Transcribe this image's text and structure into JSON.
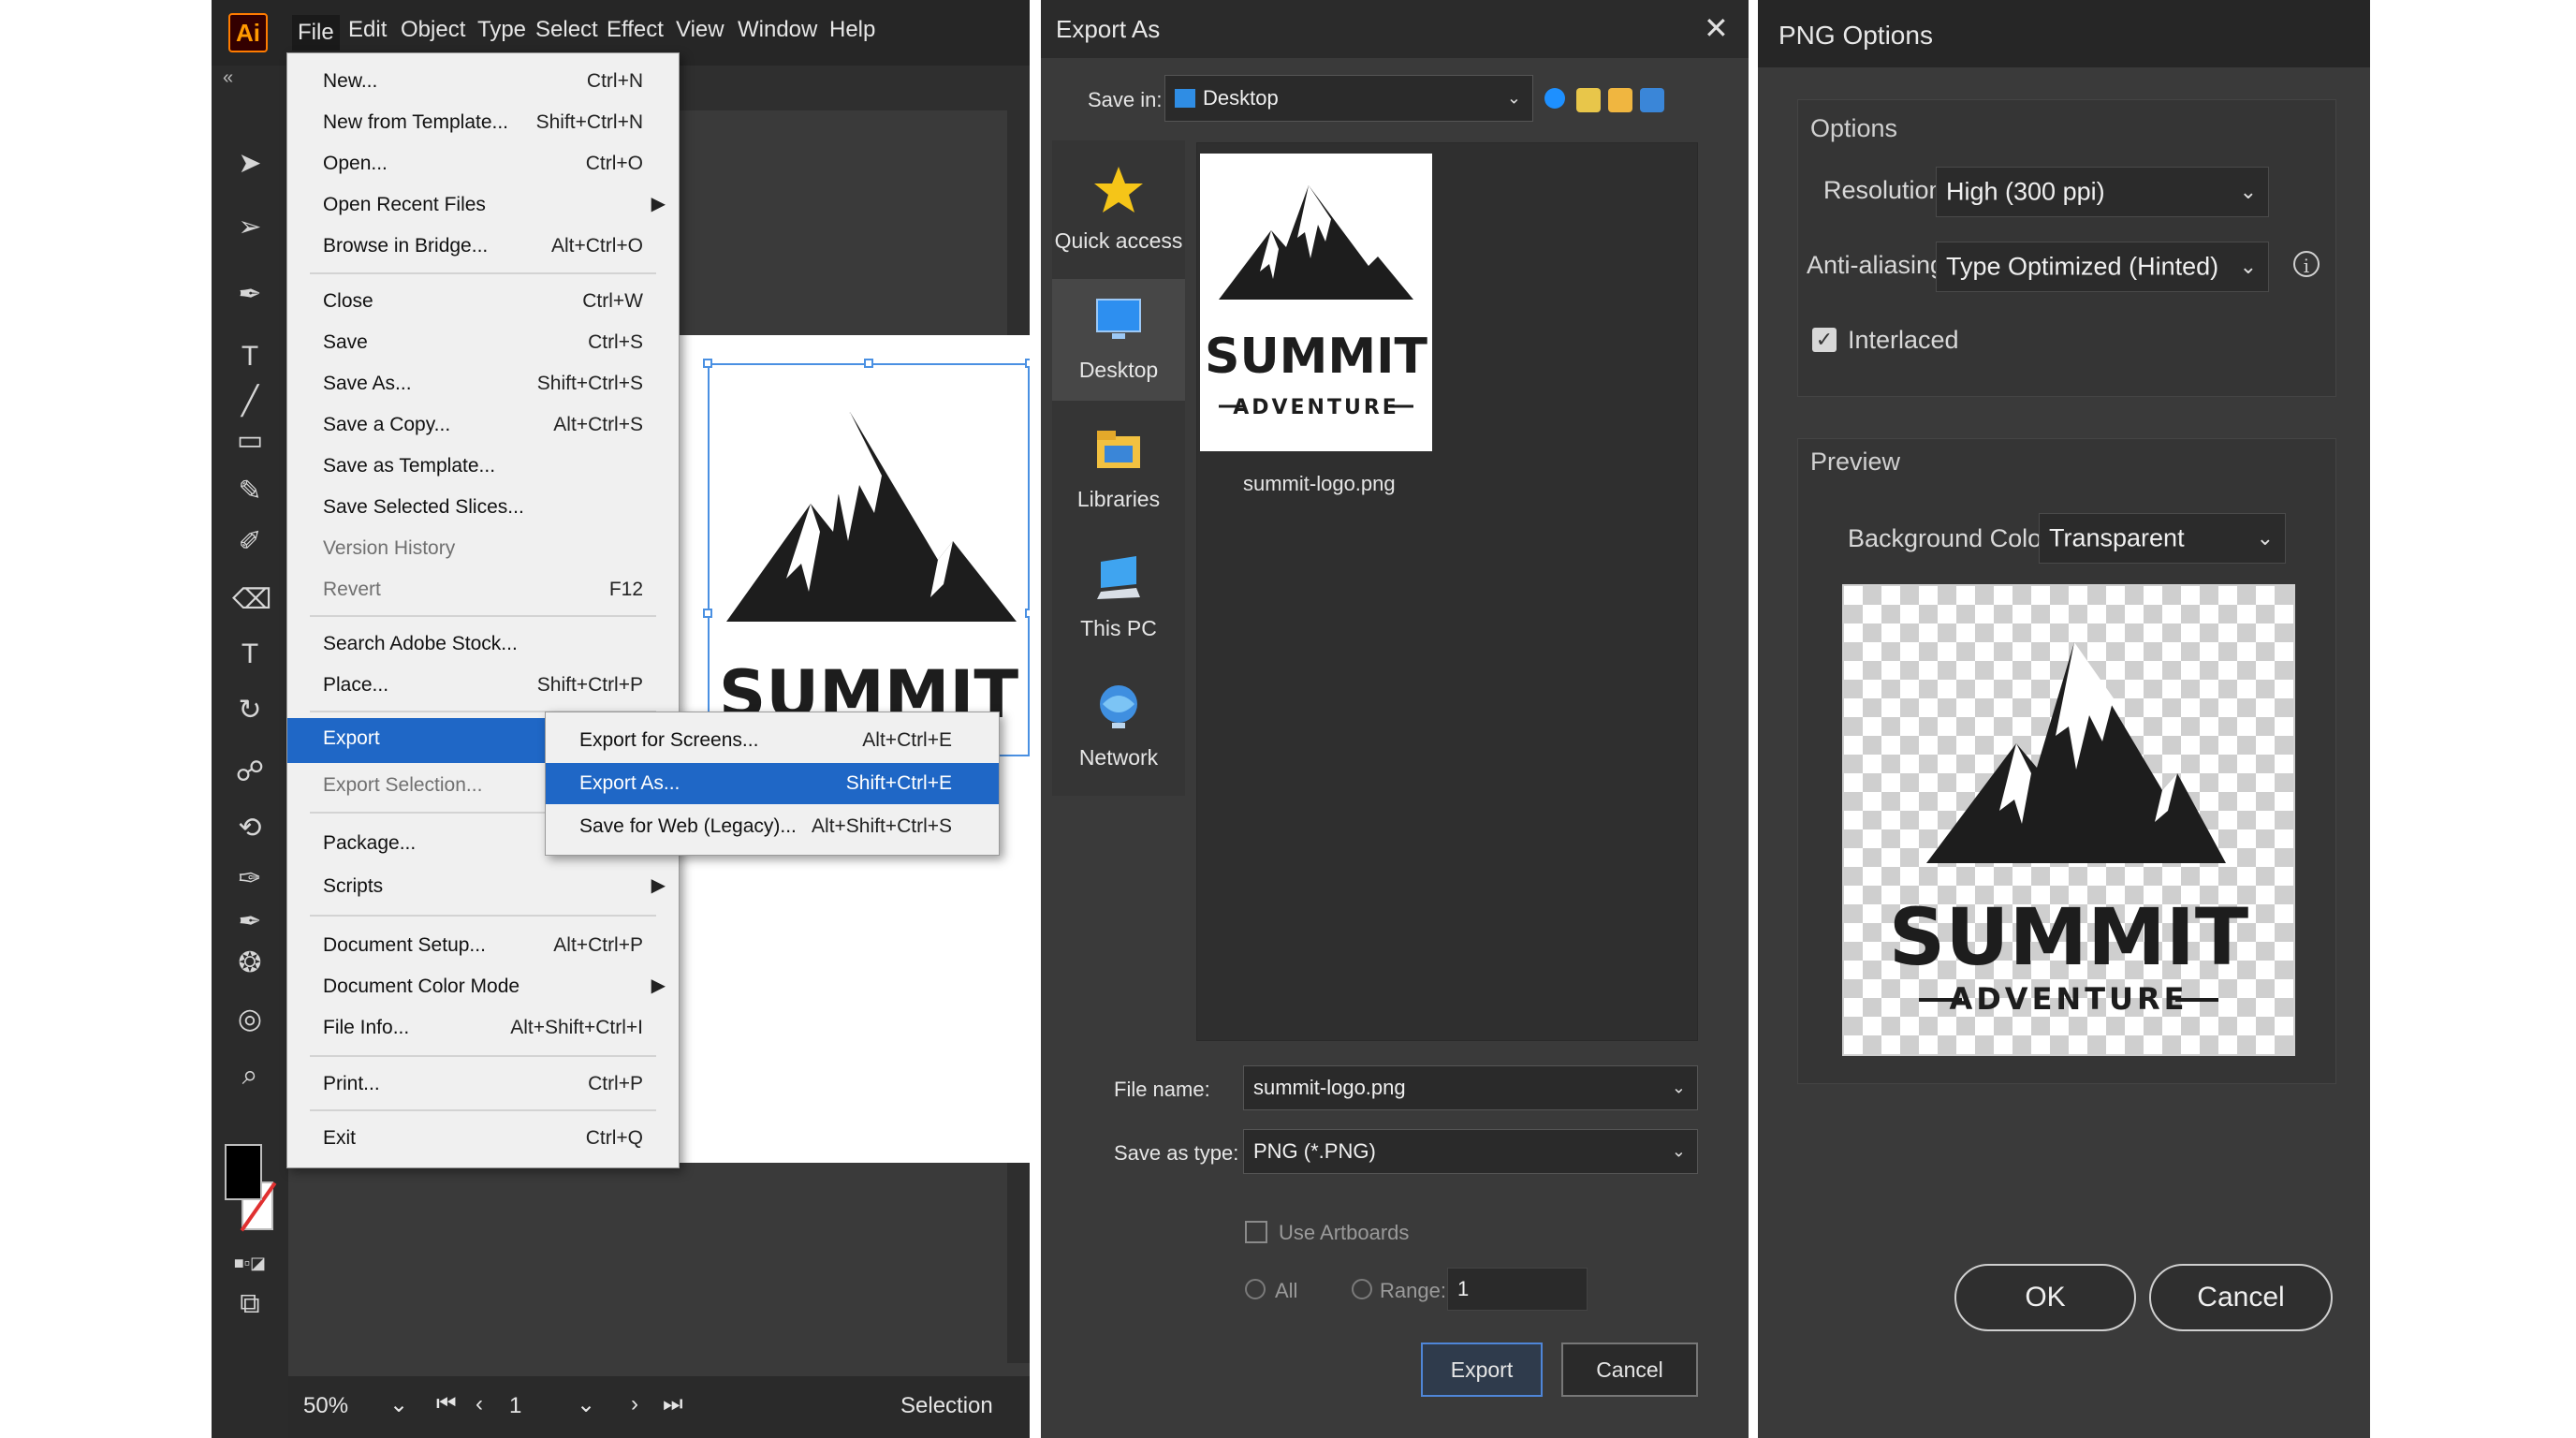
{
  "illustrator": {
    "app_logo": "Ai",
    "menubar": [
      "File",
      "Edit",
      "Object",
      "Type",
      "Select",
      "Effect",
      "View",
      "Window",
      "Help"
    ],
    "file_menu": {
      "items": [
        {
          "label": "New...",
          "shortcut": "Ctrl+N"
        },
        {
          "label": "New from Template...",
          "shortcut": "Shift+Ctrl+N"
        },
        {
          "label": "Open...",
          "shortcut": "Ctrl+O"
        },
        {
          "label": "Open Recent Files",
          "shortcut": ""
        },
        {
          "label": "Browse in Bridge...",
          "shortcut": "Alt+Ctrl+O"
        },
        {
          "label": "Close",
          "shortcut": "Ctrl+W"
        },
        {
          "label": "Save",
          "shortcut": "Ctrl+S"
        },
        {
          "label": "Save As...",
          "shortcut": "Shift+Ctrl+S"
        },
        {
          "label": "Save a Copy...",
          "shortcut": "Alt+Ctrl+S"
        },
        {
          "label": "Save as Template...",
          "shortcut": ""
        },
        {
          "label": "Save Selected Slices...",
          "shortcut": ""
        },
        {
          "label": "Version History",
          "shortcut": ""
        },
        {
          "label": "Revert",
          "shortcut": "F12"
        },
        {
          "label": "Search Adobe Stock...",
          "shortcut": ""
        },
        {
          "label": "Place...",
          "shortcut": "Shift+Ctrl+P"
        },
        {
          "label": "Export",
          "shortcut": ""
        },
        {
          "label": "Export Selection...",
          "shortcut": ""
        },
        {
          "label": "Package...",
          "shortcut": ""
        },
        {
          "label": "Scripts",
          "shortcut": ""
        },
        {
          "label": "Document Setup...",
          "shortcut": "Alt+Ctrl+P"
        },
        {
          "label": "Document Color Mode",
          "shortcut": ""
        },
        {
          "label": "File Info...",
          "shortcut": "Alt+Shift+Ctrl+I"
        },
        {
          "label": "Print...",
          "shortcut": "Ctrl+P"
        },
        {
          "label": "Exit",
          "shortcut": "Ctrl+Q"
        }
      ]
    },
    "export_submenu": [
      {
        "label": "Export for Screens...",
        "shortcut": "Alt+Ctrl+E"
      },
      {
        "label": "Export As...",
        "shortcut": "Shift+Ctrl+E"
      },
      {
        "label": "Save for Web (Legacy)...",
        "shortcut": "Alt+Shift+Ctrl+S"
      }
    ],
    "artwork_text": "SUMMIT",
    "status": {
      "zoom": "50%",
      "artboard": "1",
      "tool": "Selection"
    }
  },
  "export_dialog": {
    "title": "Export As",
    "save_in_label": "Save in:",
    "save_in_value": "Desktop",
    "places": [
      "Quick access",
      "Desktop",
      "Libraries",
      "This PC",
      "Network"
    ],
    "file": {
      "name": "summit-logo.png",
      "logo_title": "SUMMIT",
      "logo_subtitle": "ADVENTURE"
    },
    "file_name_label": "File name:",
    "file_name_value": "summit-logo.png",
    "save_type_label": "Save as type:",
    "save_type_value": "PNG (*.PNG)",
    "use_artboards": "Use Artboards",
    "all_label": "All",
    "range_label": "Range:",
    "range_value": "1",
    "export_button": "Export",
    "cancel_button": "Cancel"
  },
  "png_options": {
    "title": "PNG Options",
    "options_group": "Options",
    "resolution_label": "Resolution:",
    "resolution_value": "High (300 ppi)",
    "antialias_label": "Anti-aliasing:",
    "antialias_value": "Type Optimized (Hinted)",
    "interlaced_label": "Interlaced",
    "preview_group": "Preview",
    "bg_label": "Background Color:",
    "bg_value": "Transparent",
    "logo_title": "SUMMIT",
    "logo_subtitle": "ADVENTURE",
    "ok_button": "OK",
    "cancel_button": "Cancel"
  }
}
